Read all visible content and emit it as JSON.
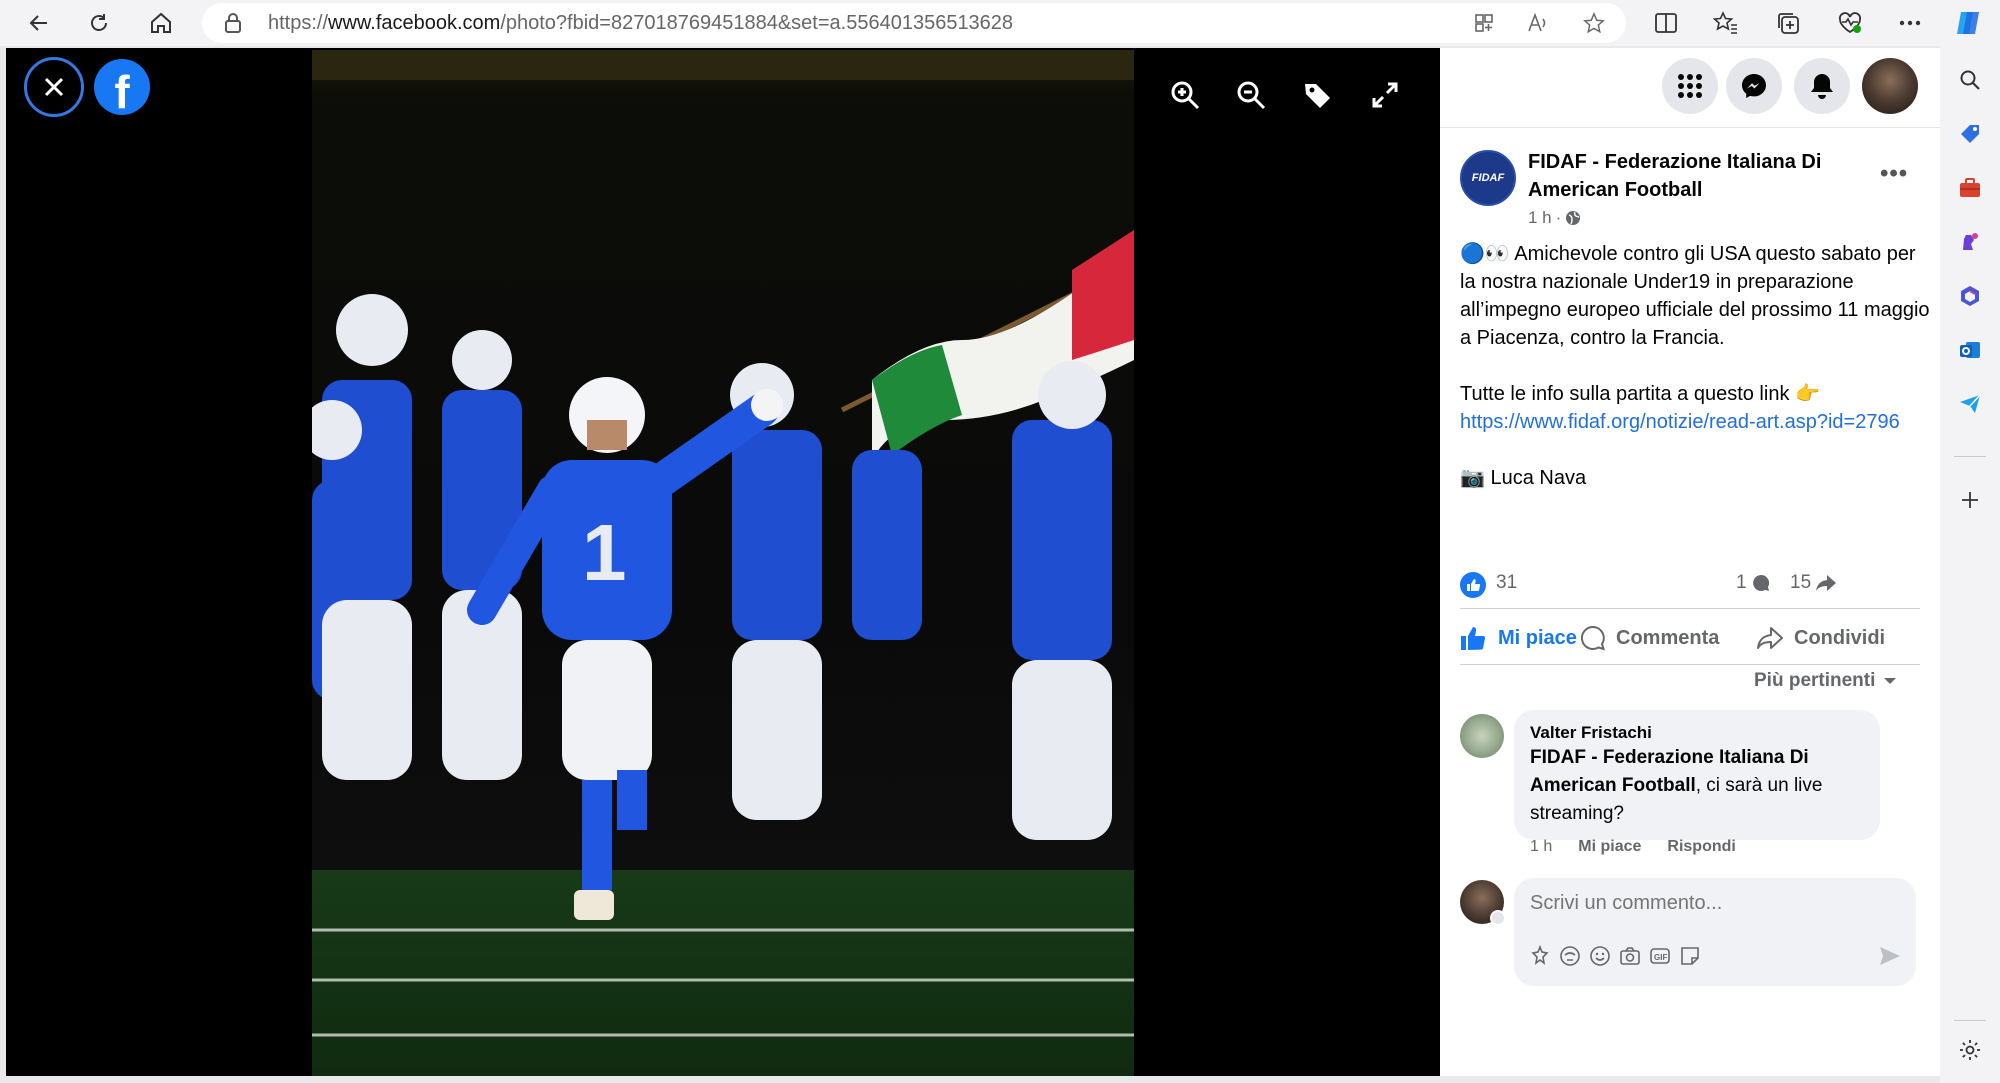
{
  "browser": {
    "url_prefix": "https://",
    "url_host": "www.facebook.com",
    "url_path": "/photo?fbid=827018769451884&set=a.556401356513628"
  },
  "viewer": {
    "logo_letter": "f"
  },
  "post": {
    "page_name": "FIDAF - Federazione Italiana Di American Football",
    "avatar_text": "FIDAF",
    "time": "1 h",
    "paragraph1": "🔵👀 Amichevole contro gli USA questo sabato per la nostra nazionale Under19 in preparazione all’impegno europeo ufficiale del prossimo 11 maggio a Piacenza, contro la Francia.",
    "paragraph2_text": "Tutte le info sulla partita a questo link 👉",
    "link": "https://www.fidaf.org/notizie/read-art.asp?id=2796",
    "credit": "📷 Luca Nava",
    "likes": "31",
    "comments_count": "1",
    "shares_count": "15"
  },
  "actions": {
    "like": "Mi piace",
    "comment": "Commenta",
    "share": "Condividi"
  },
  "sort_label": "Più pertinenti",
  "comment": {
    "author": "Valter Fristachi",
    "mention": "FIDAF - Federazione Italiana Di American Football",
    "text": ", ci sarà un live streaming?",
    "time": "1 h",
    "like": "Mi piace",
    "reply": "Rispondi"
  },
  "write_comment": {
    "placeholder": "Scrivi un commento..."
  },
  "colors": {
    "facebook_blue": "#1877f2",
    "link_blue": "#216fdb"
  }
}
